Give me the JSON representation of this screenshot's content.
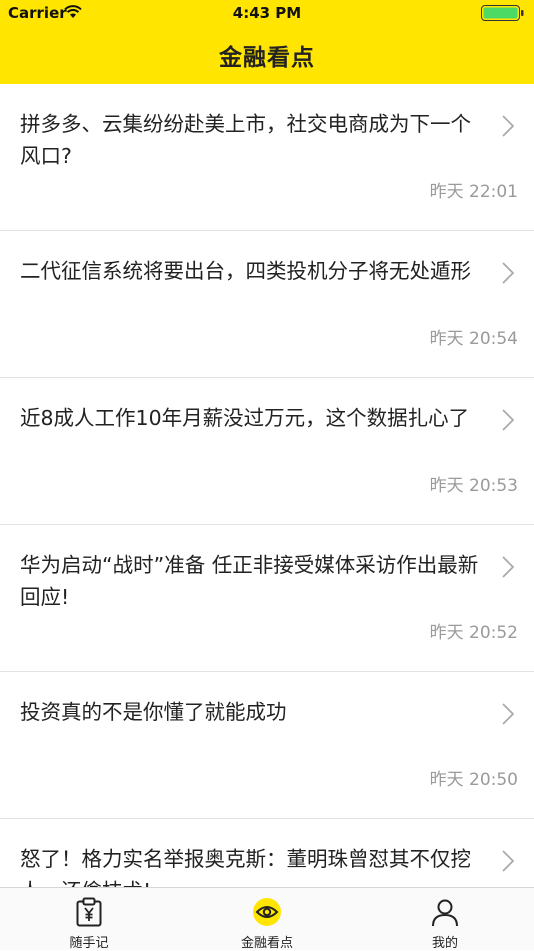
{
  "status_bar": {
    "carrier": "Carrier",
    "time": "4:43 PM"
  },
  "nav": {
    "title": "金融看点"
  },
  "colors": {
    "brand_yellow": "#FFE500",
    "time_gray": "#9a9a9a",
    "battery_green": "#4CD964"
  },
  "articles": [
    {
      "title": "拼多多、云集纷纷赴美上市，社交电商成为下一个风口?",
      "time": "昨天 22:01"
    },
    {
      "title": "二代征信系统将要出台，四类投机分子将无处遁形",
      "time": "昨天 20:54"
    },
    {
      "title": "近8成人工作10年月薪没过万元，这个数据扎心了",
      "time": "昨天 20:53"
    },
    {
      "title": "华为启动“战时”准备 任正非接受媒体采访作出最新回应!",
      "time": "昨天 20:52"
    },
    {
      "title": "投资真的不是你懂了就能成功",
      "time": "昨天 20:50"
    },
    {
      "title": "怒了！格力实名举报奥克斯：董明珠曾怼其不仅挖人，还偷技术!",
      "time": ""
    }
  ],
  "tabs": [
    {
      "label": "随手记",
      "icon": "clipboard-yen-icon"
    },
    {
      "label": "金融看点",
      "icon": "eye-icon"
    },
    {
      "label": "我的",
      "icon": "user-icon"
    }
  ]
}
